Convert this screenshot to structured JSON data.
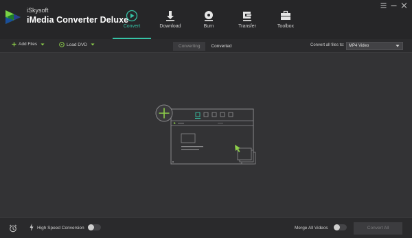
{
  "app": {
    "brand_small": "iSkysoft",
    "brand_name": "iMedia Converter Deluxe",
    "accent_color": "#36c3a6",
    "green_color": "#8ed04a"
  },
  "nav": {
    "tabs": [
      {
        "label": "Convert",
        "icon": "play-circle-icon",
        "active": true
      },
      {
        "label": "Download",
        "icon": "download-icon",
        "active": false
      },
      {
        "label": "Burn",
        "icon": "disc-icon",
        "active": false
      },
      {
        "label": "Transfer",
        "icon": "transfer-icon",
        "active": false
      },
      {
        "label": "Toolbox",
        "icon": "toolbox-icon",
        "active": false
      }
    ]
  },
  "window_controls": [
    "menu-icon",
    "minimize-icon",
    "close-icon"
  ],
  "toolbar": {
    "add_files": "Add Files",
    "load_dvd": "Load DVD",
    "segment": {
      "converting": "Converting",
      "converted": "Converted"
    },
    "convert_all_label": "Convert all files to:",
    "format_value": "MP4 Video"
  },
  "footer": {
    "high_speed_label": "High Speed Conversion",
    "merge_label": "Merge All Videos",
    "convert_all_button": "Convert All"
  }
}
